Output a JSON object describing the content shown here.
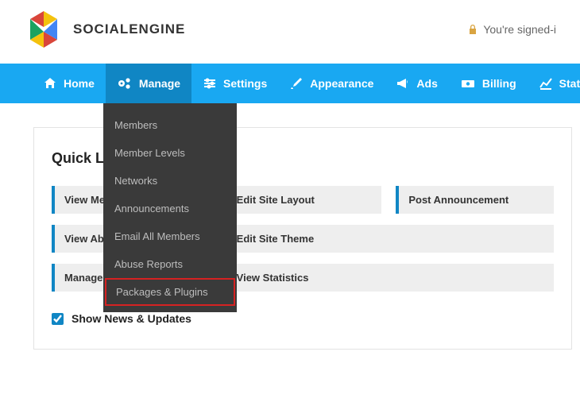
{
  "brand": {
    "name": "SOCIALENGINE"
  },
  "auth": {
    "signed_in_text": "You're signed-i"
  },
  "nav": {
    "home": "Home",
    "manage": "Manage",
    "settings": "Settings",
    "appearance": "Appearance",
    "ads": "Ads",
    "billing": "Billing",
    "stats": "Stats"
  },
  "manage_menu": {
    "members": "Members",
    "member_levels": "Member Levels",
    "networks": "Networks",
    "announcements": "Announcements",
    "email_all": "Email All Members",
    "abuse_reports": "Abuse Reports",
    "packages_plugins": "Packages & Plugins"
  },
  "quick_links": {
    "title": "Quick Links",
    "view_members": "View Members",
    "edit_layout": "Edit Site Layout",
    "post_announcement": "Post Announcement",
    "view_abuse": "View Abuse Reports",
    "edit_theme": "Edit Site Theme",
    "manage_plugins": "Manage Plugins",
    "view_statistics": "View Statistics"
  },
  "news": {
    "label": "Show News & Updates",
    "checked": true
  }
}
